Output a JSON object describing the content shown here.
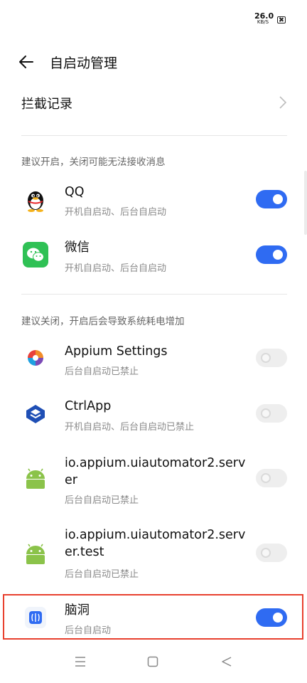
{
  "status_bar": {
    "net_speed_value": "26.0",
    "net_speed_unit": "KB/S",
    "sim_icon": "no-sim-icon"
  },
  "header": {
    "title": "自启动管理",
    "back_icon": "back-arrow-icon"
  },
  "intercept_record": {
    "label": "拦截记录",
    "icon": "chevron-right-icon"
  },
  "recommend_on": {
    "heading": "建议开启，关闭可能无法接收消息",
    "apps": [
      {
        "name": "QQ",
        "desc": "开机自启动、后台自启动",
        "enabled": true,
        "icon": "qq-penguin-icon"
      },
      {
        "name": "微信",
        "desc": "开机自启动、后台自启动",
        "enabled": true,
        "icon": "wechat-icon"
      }
    ]
  },
  "recommend_off": {
    "heading": "建议关闭，开启后会导致系统耗电增加",
    "apps": [
      {
        "name": "Appium Settings",
        "desc": "后台自启动已禁止",
        "enabled": false,
        "icon": "appium-icon"
      },
      {
        "name": "CtrlApp",
        "desc": "开机自启动、后台自启动已禁止",
        "enabled": false,
        "icon": "ctrlapp-icon"
      },
      {
        "name": "io.appium.uiautomator2.server",
        "desc": "后台自启动已禁止",
        "enabled": false,
        "icon": "android-icon"
      },
      {
        "name": "io.appium.uiautomator2.server.test",
        "desc": "后台自启动已禁止",
        "enabled": false,
        "icon": "android-icon"
      },
      {
        "name": "脑洞",
        "desc": "后台自启动",
        "enabled": true,
        "icon": "naodong-icon",
        "highlighted": true
      }
    ]
  },
  "nav_bar": {
    "menu_icon": "menu-icon",
    "home_icon": "home-square-icon",
    "back_icon": "back-triangle-icon"
  },
  "colors": {
    "accent": "#2f6bf2",
    "highlight_border": "#e8402e"
  }
}
